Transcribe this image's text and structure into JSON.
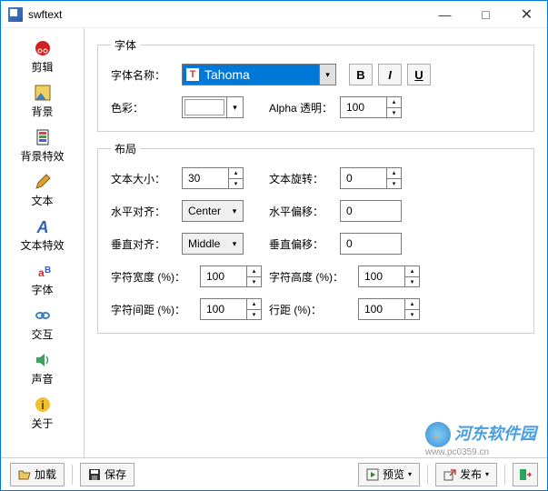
{
  "app": {
    "title": "swftext"
  },
  "win": {
    "min": "—",
    "max": "□",
    "close": "✕"
  },
  "sidebar": {
    "items": [
      {
        "label": "剪辑"
      },
      {
        "label": "背景"
      },
      {
        "label": "背景特效"
      },
      {
        "label": "文本"
      },
      {
        "label": "文本特效"
      },
      {
        "label": "字体"
      },
      {
        "label": "交互"
      },
      {
        "label": "声音"
      },
      {
        "label": "关于"
      }
    ]
  },
  "font_group": {
    "legend": "字体",
    "font_label": "字体名称：",
    "font_value": "Tahoma",
    "color_label": "色彩：",
    "color_value": "#ffffff",
    "alpha_label": "Alpha 透明：",
    "alpha_value": "100",
    "bold": "B",
    "italic": "I",
    "underline": "U"
  },
  "layout_group": {
    "legend": "布局",
    "size_label": "文本大小：",
    "size_value": "30",
    "rotate_label": "文本旋转：",
    "rotate_value": "0",
    "halign_label": "水平对齐：",
    "halign_value": "Center",
    "hoffset_label": "水平偏移：",
    "hoffset_value": "0",
    "valign_label": "垂直对齐：",
    "valign_value": "Middle",
    "voffset_label": "垂直偏移：",
    "voffset_value": "0",
    "cwidth_label": "字符宽度 (%)：",
    "cwidth_value": "100",
    "cheight_label": "字符高度 (%)：",
    "cheight_value": "100",
    "cspace_label": "字符间距 (%)：",
    "cspace_value": "100",
    "lspace_label": "行距 (%)：",
    "lspace_value": "100"
  },
  "bottom": {
    "load": "加载",
    "save": "保存",
    "preview": "预览",
    "publish": "发布"
  },
  "watermark": {
    "text": "河东软件园",
    "url": "www.pc0359.cn"
  }
}
